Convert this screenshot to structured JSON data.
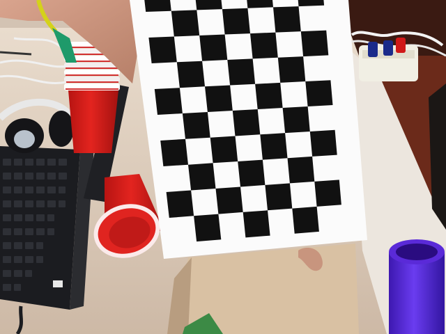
{
  "scene": {
    "description_labels": [],
    "checkerboard": {
      "rows": 10,
      "cols": 7
    },
    "colors": {
      "wall": "#3a1a12",
      "table": "#d8c8b8",
      "shelf": "#e8e2da",
      "board_paper": "#fbfbfb",
      "square": "#111111",
      "cup_red": "#d8201c",
      "cylinder_purple": "#5a2ad8",
      "keyboard": "#1b1c20",
      "skin": "#c8957e",
      "power_strip": "#f1efe4"
    }
  }
}
